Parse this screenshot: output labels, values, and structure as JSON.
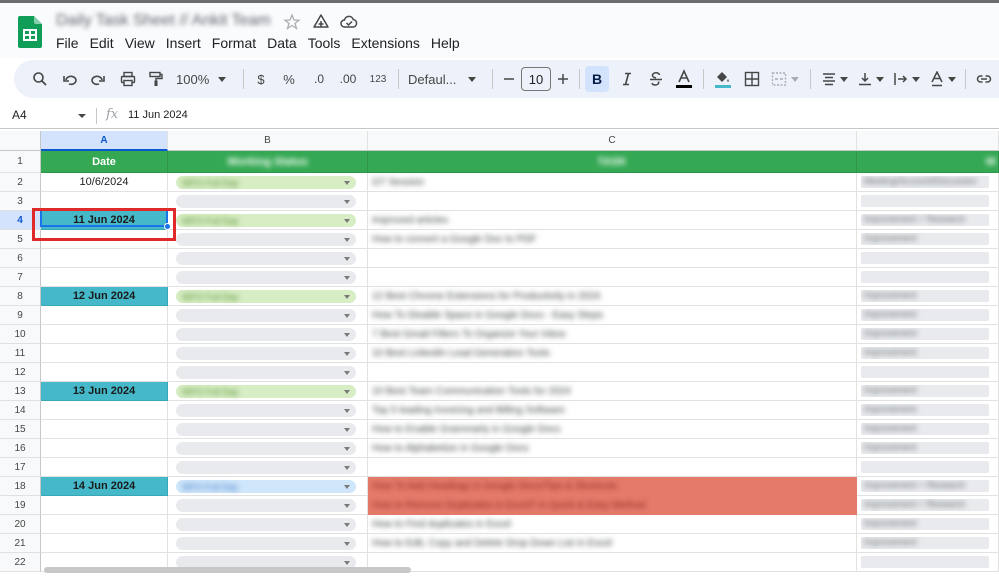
{
  "app": {
    "doc_title": "Daily Task Sheet // Ankit Team",
    "colors": {
      "brand_green": "#0f9d58",
      "header_green": "#34a853",
      "date_teal": "#45b9c9",
      "selection_blue": "#1a73e8",
      "annotation_red": "#e02a2a",
      "task_red": "#e57a6a"
    }
  },
  "menu": [
    "File",
    "Edit",
    "View",
    "Insert",
    "Format",
    "Data",
    "Tools",
    "Extensions",
    "Help"
  ],
  "toolbar": {
    "zoom": "100%",
    "currency": "$",
    "percent": "%",
    "dec_decrease": ".0",
    "dec_increase": ".00",
    "number_format": "123",
    "font_name": "Defaul...",
    "font_size": "10",
    "icons": [
      "search-icon",
      "undo-icon",
      "redo-icon",
      "print-icon",
      "paint-format-icon",
      "bold-icon",
      "italic-icon",
      "strikethrough-icon",
      "text-color-icon",
      "fill-color-icon",
      "borders-icon",
      "merge-cells-icon",
      "align-icon",
      "valign-icon",
      "text-wrap-icon",
      "text-rotate-icon",
      "link-icon"
    ]
  },
  "formula_bar": {
    "cell_ref": "A4",
    "fx": "fx",
    "value": "11 Jun 2024"
  },
  "columns": [
    "A",
    "B",
    "C"
  ],
  "header_row": {
    "date": "Date",
    "status": "Working Status",
    "task": "TASK",
    "type": "W"
  },
  "rows": [
    {
      "num": "2",
      "date": "10/6/2024",
      "date_hl": false,
      "status": "WFO Full Day",
      "status_color": "green",
      "task": "GT Session",
      "task_red": false,
      "type": "Meeting/Account/Discussion"
    },
    {
      "num": "3",
      "date": "",
      "date_hl": false,
      "status": "",
      "status_color": "grey",
      "task": "",
      "task_red": false,
      "type": ""
    },
    {
      "num": "4",
      "date": "11 Jun 2024",
      "date_hl": true,
      "status": "WFO Full Day",
      "status_color": "green",
      "task": "Improved articles",
      "task_red": false,
      "type": "Improvement + Research"
    },
    {
      "num": "5",
      "date": "",
      "date_hl": false,
      "status": "",
      "status_color": "grey",
      "task": "How to convert a Google Doc to PDF",
      "task_red": false,
      "type": "Improvement"
    },
    {
      "num": "6",
      "date": "",
      "date_hl": false,
      "status": "",
      "status_color": "grey",
      "task": "",
      "task_red": false,
      "type": ""
    },
    {
      "num": "7",
      "date": "",
      "date_hl": false,
      "status": "",
      "status_color": "grey",
      "task": "",
      "task_red": false,
      "type": ""
    },
    {
      "num": "8",
      "date": "12 Jun 2024",
      "date_hl": true,
      "status": "WFO Full Day",
      "status_color": "green",
      "task": "12 Best Chrome Extensions for Productivity in 2024",
      "task_red": false,
      "type": "Improvement"
    },
    {
      "num": "9",
      "date": "",
      "date_hl": false,
      "status": "",
      "status_color": "grey",
      "task": "How To Disable Space in Google Docs - Easy Steps",
      "task_red": false,
      "type": "Improvement"
    },
    {
      "num": "10",
      "date": "",
      "date_hl": false,
      "status": "",
      "status_color": "grey",
      "task": "7 Best Gmail Filters To Organize Your Inbox",
      "task_red": false,
      "type": "Improvement"
    },
    {
      "num": "11",
      "date": "",
      "date_hl": false,
      "status": "",
      "status_color": "grey",
      "task": "10 Best LinkedIn Lead Generation Tools",
      "task_red": false,
      "type": "Improvement"
    },
    {
      "num": "12",
      "date": "",
      "date_hl": false,
      "status": "",
      "status_color": "grey",
      "task": "",
      "task_red": false,
      "type": ""
    },
    {
      "num": "13",
      "date": "13 Jun 2024",
      "date_hl": true,
      "status": "WFO Full Day",
      "status_color": "green",
      "task": "10 Best Team Communication Tools for 2024",
      "task_red": false,
      "type": "Improvement"
    },
    {
      "num": "14",
      "date": "",
      "date_hl": false,
      "status": "",
      "status_color": "grey",
      "task": "Top 5 leading Invoicing and Billing Software",
      "task_red": false,
      "type": "Improvement"
    },
    {
      "num": "15",
      "date": "",
      "date_hl": false,
      "status": "",
      "status_color": "grey",
      "task": "How to Enable Grammarly in Google Docs",
      "task_red": false,
      "type": "Improvement"
    },
    {
      "num": "16",
      "date": "",
      "date_hl": false,
      "status": "",
      "status_color": "grey",
      "task": "How to Alphabetize in Google Docs",
      "task_red": false,
      "type": "Improvement"
    },
    {
      "num": "17",
      "date": "",
      "date_hl": false,
      "status": "",
      "status_color": "grey",
      "task": "",
      "task_red": false,
      "type": ""
    },
    {
      "num": "18",
      "date": "14 Jun 2024",
      "date_hl": true,
      "status": "WFH Full Day",
      "status_color": "blue",
      "task": "How To Add Headings in Google Docs/Tips & Shortcuts",
      "task_red": true,
      "type": "Improvement + Research"
    },
    {
      "num": "19",
      "date": "",
      "date_hl": false,
      "status": "",
      "status_color": "grey",
      "task": "How to Remove Duplicates in Excel? in Quick & Easy Method",
      "task_red": true,
      "type": "Improvement + Research"
    },
    {
      "num": "20",
      "date": "",
      "date_hl": false,
      "status": "",
      "status_color": "grey",
      "task": "How to Find duplicates in Excel",
      "task_red": false,
      "type": "Improvement"
    },
    {
      "num": "21",
      "date": "",
      "date_hl": false,
      "status": "",
      "status_color": "grey",
      "task": "How to Edit, Copy and Delete Drop Down List in Excel",
      "task_red": false,
      "type": "Improvement"
    },
    {
      "num": "22",
      "date": "",
      "date_hl": false,
      "status": "",
      "status_color": "grey",
      "task": "",
      "task_red": false,
      "type": ""
    }
  ]
}
